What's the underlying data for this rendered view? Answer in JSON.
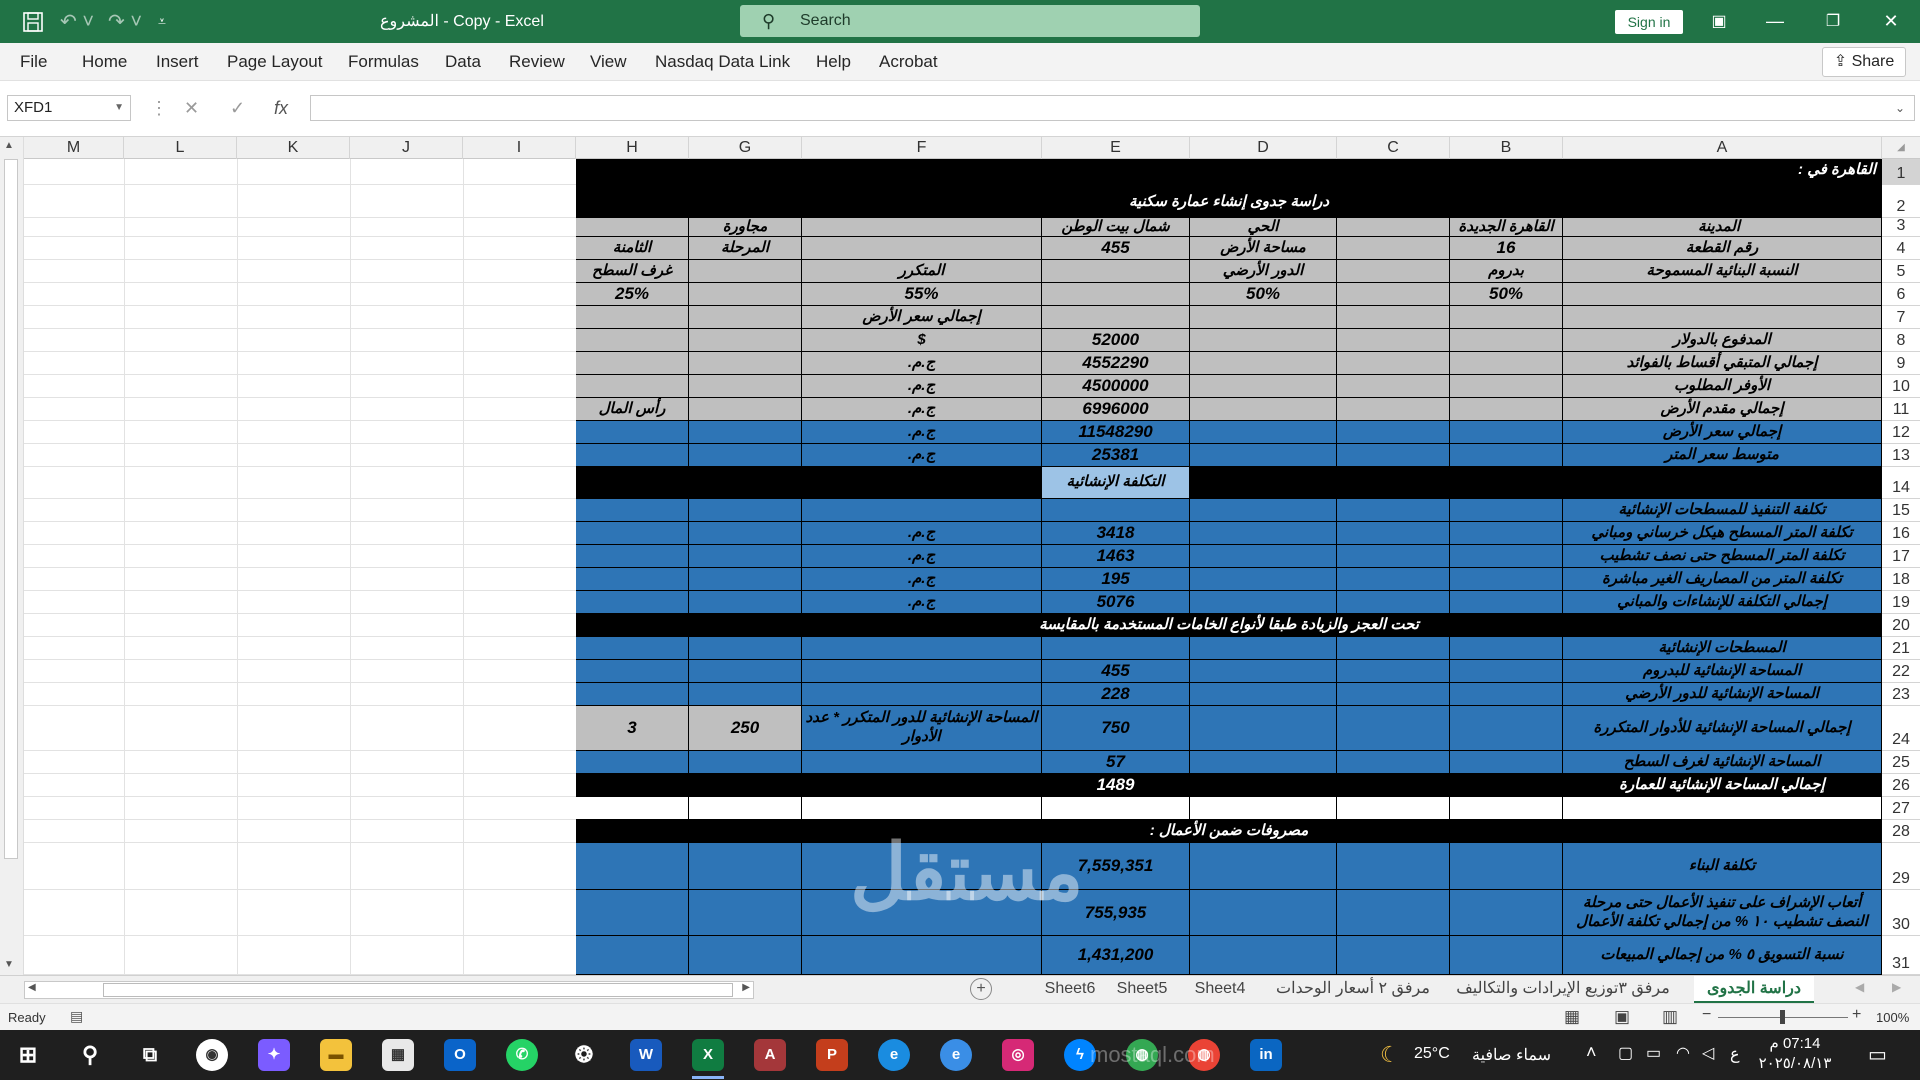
{
  "window": {
    "title": "المشروع - Copy  -  Excel",
    "search_placeholder": "Search",
    "signin_label": "Sign in",
    "share_label": "Share"
  },
  "ribbon": {
    "tabs": [
      "File",
      "Home",
      "Insert",
      "Page Layout",
      "Formulas",
      "Data",
      "Review",
      "View",
      "Nasdaq Data Link",
      "Help",
      "Acrobat"
    ]
  },
  "formula_bar": {
    "name_box": "XFD1",
    "fx": "fx",
    "value": ""
  },
  "columns": [
    "M",
    "L",
    "K",
    "J",
    "I",
    "H",
    "G",
    "F",
    "E",
    "D",
    "C",
    "B",
    "A"
  ],
  "rows": [
    "1",
    "2",
    "3",
    "4",
    "5",
    "6",
    "7",
    "8",
    "9",
    "10",
    "11",
    "12",
    "13",
    "14",
    "15",
    "16",
    "17",
    "18",
    "19",
    "20",
    "21",
    "22",
    "23",
    "24",
    "25",
    "26",
    "27",
    "28",
    "29",
    "30",
    "31"
  ],
  "sheet": {
    "r1_A": "القاهرة في :",
    "r2_title": "دراسة جدوى إنشاء عمارة سكنية",
    "r3_A": "المدينة",
    "r3_B": "القاهرة الجديدة",
    "r3_D": "الحي",
    "r3_E": "شمال بيت الوطن",
    "r3_G": "مجاورة",
    "r4_A": "رقم القطعة",
    "r4_B": "16",
    "r4_D": "مساحة الأرض",
    "r4_E": "455",
    "r4_G": "المرحلة",
    "r4_H": "الثامنة",
    "r5_A": "النسبة البنائية المسموحة",
    "r5_B": "بدروم",
    "r5_D": "الدور الأرضي",
    "r5_F": "المتكرر",
    "r5_H": "غرف السطح",
    "r6_B": "50%",
    "r6_D": "50%",
    "r6_F": "55%",
    "r6_H": "25%",
    "r7_F": "إجمالي سعر الأرض",
    "r8_A": "المدفوع بالدولار",
    "r8_E": "52000",
    "r8_F": "$",
    "r9_A": "إجمالي المتبقي أقساط بالفوائد",
    "r9_E": "4552290",
    "r9_F": "ج.م.",
    "r10_A": "الأوفر المطلوب",
    "r10_E": "4500000",
    "r10_F": "ج.م.",
    "r11_A": "إجمالي مقدم الأرض",
    "r11_E": "6996000",
    "r11_F": "ج.م.",
    "r11_H": "رأس المال",
    "r12_A": "إجمالي سعر الأرض",
    "r12_E": "11548290",
    "r12_F": "ج.م.",
    "r13_A": "متوسط سعر المتر",
    "r13_E": "25381",
    "r13_F": "ج.م.",
    "r14_E": "التكلفة الإنشائية",
    "r15_A": "تكلفة التنفيذ للمسطحات الإنشائية",
    "r16_A": "تكلفة المتر المسطح هيكل خرساني ومباني",
    "r16_E": "3418",
    "r16_F": "ج.م.",
    "r17_A": "تكلفة المتر المسطح حتى نصف تشطيب",
    "r17_E": "1463",
    "r17_F": "ج.م.",
    "r18_A": "تكلفة المتر من المصاريف الغير مباشرة",
    "r18_E": "195",
    "r18_F": "ج.م.",
    "r19_A": "إجمالي التكلفة للإنشاءات والمباني",
    "r19_E": "5076",
    "r19_F": "ج.م.",
    "r20_text": "تحت العجز والزيادة طبقا لأنواع الخامات  المستخدمة بالمقايسة",
    "r21_A": "المسطحات الإنشائية",
    "r22_A": "المساحة الإنشائية للبدروم",
    "r22_E": "455",
    "r23_A": "المساحة الإنشائية للدور الأرضي",
    "r23_E": "228",
    "r24_A": "إجمالي المساحة الإنشائية للأدوار المتكررة",
    "r24_E": "750",
    "r24_F": "المساحة الإنشائية للدور المتكرر * عدد الأدوار",
    "r24_G": "250",
    "r24_H": "3",
    "r25_A": "المساحة الإنشائية لغرف السطح",
    "r25_E": "57",
    "r26_A": "إجمالي المساحة الإنشائية للعمارة",
    "r26_E": "1489",
    "r28_text": "مصروفات ضمن الأعمال :",
    "r29_A": "تكلفة البناء",
    "r29_E": "7,559,351",
    "r30_A": "أتعاب الإشراف على تنفيذ الأعمال حتى مرحلة النصف تشطيب ١٠ % من إجمالي تكلفة الأعمال",
    "r30_E": "755,935",
    "r31_A": "نسبة التسويق ٥ % من إجمالي المبيعات",
    "r31_E": "1,431,200"
  },
  "sheet_tabs": [
    "دراسة الجدوى",
    "مرفق ٣توزيع الإيرادات والتكاليف",
    "مرفق ٢ أسعار الوحدات",
    "Sheet4",
    "Sheet5",
    "Sheet6"
  ],
  "status": {
    "ready": "Ready",
    "zoom": "100%"
  },
  "taskbar": {
    "weather_temp": "25°C",
    "weather_text": "سماء صافية",
    "time": "07:14 م",
    "date": "٢٠٢٥/٠٨/١٣",
    "lang": "ع"
  },
  "watermark": {
    "ar": "مستقل",
    "en": "mostaql.com"
  }
}
